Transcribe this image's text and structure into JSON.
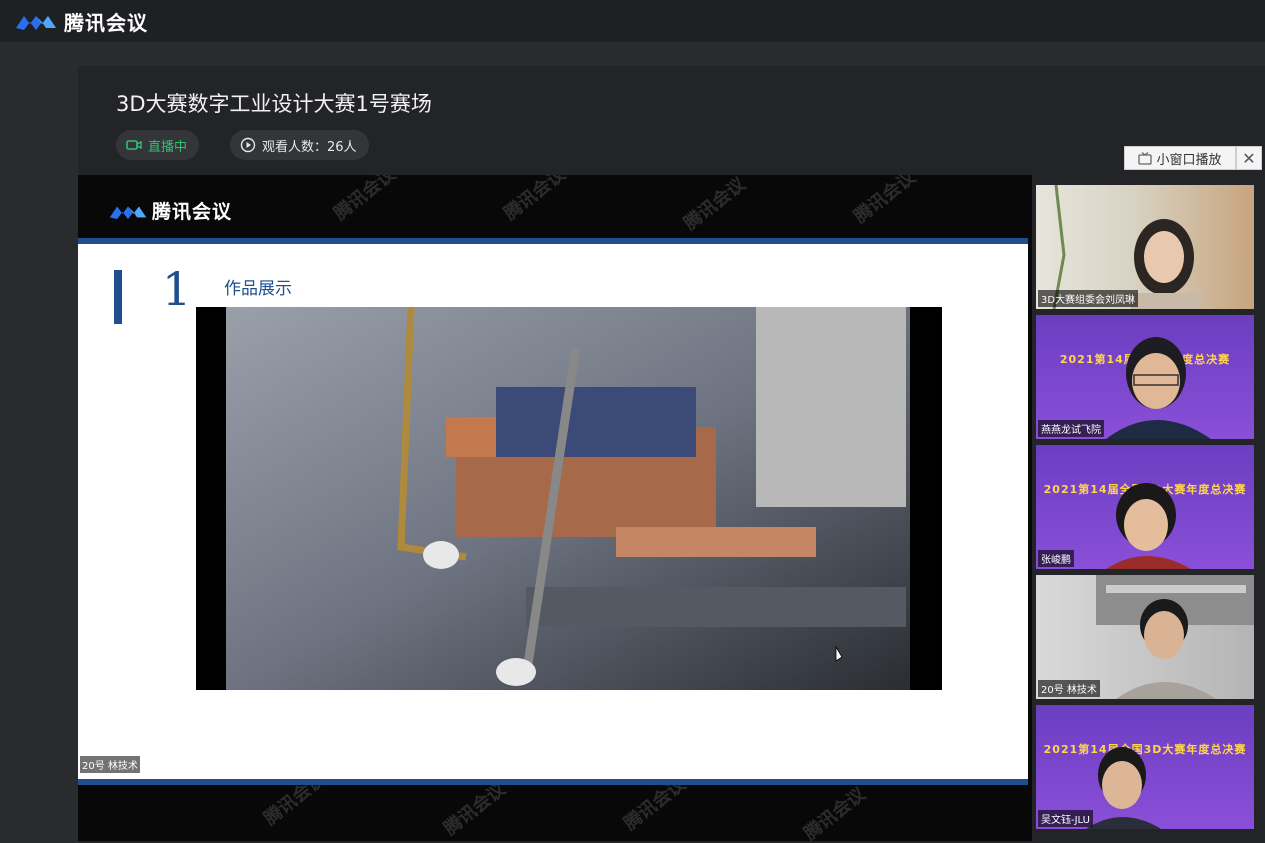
{
  "app": {
    "name": "腾讯会议",
    "brand_color": "#2a6ff0"
  },
  "room": {
    "title": "3D大赛数字工业设计大赛1号赛场",
    "live_badge": "直播中",
    "viewers": "观看人数：26人",
    "live_color": "#31c06f"
  },
  "controls": {
    "mini_window": "小窗口播放",
    "close": "✕"
  },
  "share": {
    "logo_text": "腾讯会议",
    "watermark": "腾讯会议",
    "slide_number": "1",
    "slide_heading": "作品展示",
    "presenter_label": "20号 林技术",
    "accent": "#1f4f8c"
  },
  "participants": [
    {
      "name": "3D大赛组委会刘凤琳",
      "banner": ""
    },
    {
      "name": "燕燕龙试飞院",
      "banner": "2021第14届..大赛年度总决赛"
    },
    {
      "name": "张峻鹏",
      "banner": "2021第14届全国3D大赛年度总决赛"
    },
    {
      "name": "20号 林技术",
      "banner": ""
    },
    {
      "name": "吴文钰-JLU",
      "banner": "2021第14届全国3D大赛年度总决赛"
    }
  ]
}
